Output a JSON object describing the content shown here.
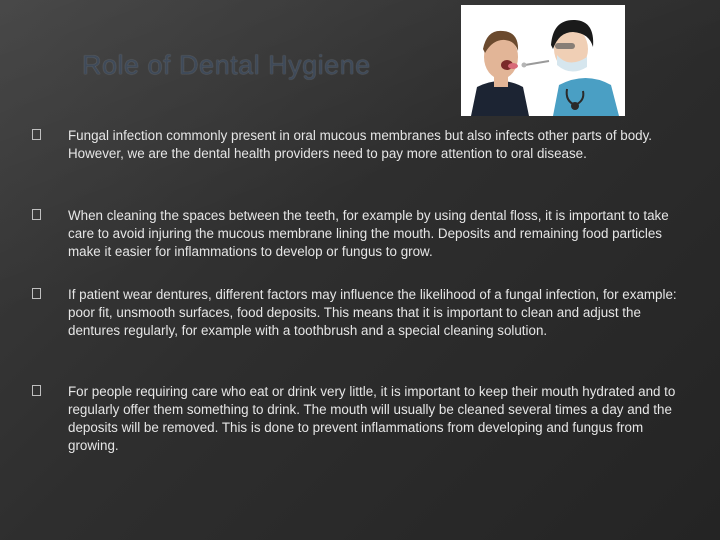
{
  "slide": {
    "title": "Role of Dental Hygiene",
    "image": {
      "description_icon": "dentist-examining-patient-photo"
    },
    "bullets": [
      {
        "text": "Fungal infection commonly present in oral mucous membranes but also infects other parts of body. However, we are the dental health providers need to pay more attention to oral disease."
      },
      {
        "text": "When cleaning the spaces between the teeth, for example by using dental floss, it is important to take care to avoid injuring the mucous membrane lining the mouth. Deposits and remaining food particles make it easier for inflammations to develop or fungus to grow."
      },
      {
        "text": "If  patient wear dentures, different factors may influence the likelihood of a fungal infection, for example: poor fit, unsmooth surfaces, food deposits. This means that it is important to clean and adjust the dentures regularly, for example with a toothbrush and a special cleaning solution."
      },
      {
        "text": "For people requiring care who eat or drink very little, it is important to keep their mouth hydrated and to regularly offer them something to drink. The mouth will usually be cleaned several times a day and the deposits will be removed. This is done to prevent inflammations from developing and fungus from growing."
      }
    ]
  }
}
